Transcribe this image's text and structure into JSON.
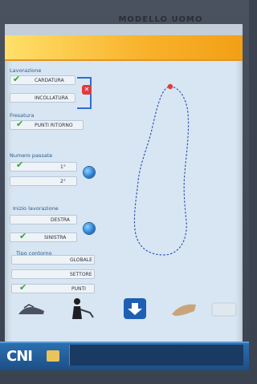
{
  "header": {
    "title": "MODELLO UOMO"
  },
  "sections": {
    "lavorazione": {
      "label": "Lavorazione"
    },
    "fresatura": {
      "label": "Fresatura"
    },
    "numero_passate": {
      "label": "Numero passate"
    },
    "inizio": {
      "label": "Inizio lavorazione"
    },
    "tipo_contorno": {
      "label": "Tipo contorno"
    }
  },
  "options": {
    "cardatura": "CARDATURA",
    "incollatura": "INCOLLATURA",
    "punti_ritorno": "PUNTI RITORNO",
    "passate_1": "1°",
    "passate_2": "2°",
    "destra": "DESTRA",
    "sinistra": "SINISTRA",
    "globale": "GLOBALE",
    "settore": "SETTORE",
    "punti": "PUNTI"
  },
  "colors": {
    "header_gradient": [
      "#ffe06a",
      "#f2a016"
    ],
    "screen_bg": "#d7e6f2",
    "check": "#2fa52a",
    "contour": "#2f52b8",
    "start_point": "#e03b3b"
  },
  "icons": {
    "check": "check-icon",
    "error": "error-x-icon",
    "globe": "globe-icon",
    "tools": [
      "shoe-tool-icon",
      "worker-icon",
      "download-icon",
      "shoe-profile-icon",
      "blank-tool-icon"
    ]
  },
  "dock": {
    "logo_text": "CNI"
  }
}
